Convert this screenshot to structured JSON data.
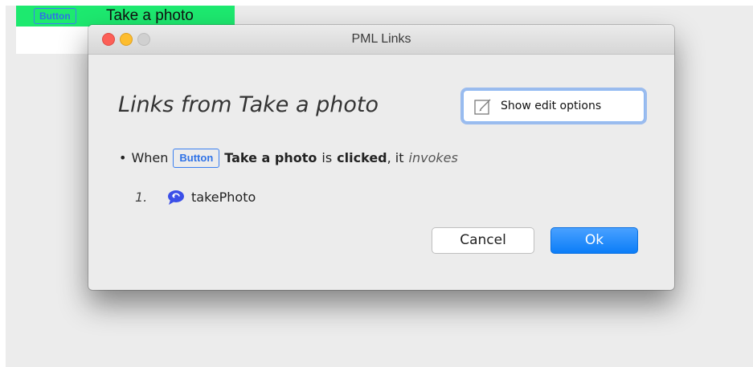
{
  "background_element": {
    "tag_label": "Button",
    "element_label": "Take a photo"
  },
  "dialog": {
    "window_title": "PML Links",
    "heading": "Links from Take a photo",
    "edit_button_label": "Show edit options",
    "rule": {
      "bullet": "•",
      "when": "When",
      "tag_label": "Button",
      "element_name": "Take a photo",
      "is": "is",
      "event": "clicked",
      "it": ", it",
      "action": "invokes"
    },
    "items": [
      {
        "number": "1.",
        "label": "takePhoto",
        "icon": "speech-bubble-icon"
      }
    ],
    "cancel_label": "Cancel",
    "ok_label": "Ok"
  },
  "colors": {
    "accent": "#0b7df8",
    "tag_blue": "#2f72e6",
    "highlight_green": "#1de96f",
    "close": "#fc5f57",
    "minimize": "#fdbd2e",
    "zoom_inactive": "#d0d0d0"
  }
}
